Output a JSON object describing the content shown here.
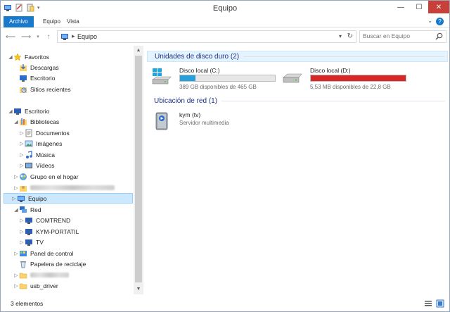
{
  "window": {
    "title": "Equipo"
  },
  "ribbon": {
    "tabs": [
      "Archivo",
      "Equipo",
      "Vista"
    ],
    "help": "?"
  },
  "address": {
    "path": "Equipo",
    "separator": "▸"
  },
  "search": {
    "placeholder": "Buscar en Equipo"
  },
  "nav": {
    "favorites": {
      "label": "Favoritos",
      "items": [
        "Descargas",
        "Escritorio",
        "Sitios recientes"
      ]
    },
    "desktop": {
      "label": "Escritorio"
    },
    "libraries": {
      "label": "Bibliotecas",
      "items": [
        "Documentos",
        "Imágenes",
        "Música",
        "Vídeos"
      ]
    },
    "homegroup": "Grupo en el hogar",
    "computer": "Equipo",
    "network": {
      "label": "Red",
      "items": [
        "COMTREND",
        "KYM-PORTATIL",
        "TV"
      ]
    },
    "control_panel": "Panel de control",
    "recycle_bin": "Papelera de reciclaje",
    "usb_driver": "usb_driver"
  },
  "content": {
    "drives_header": "Unidades de disco duro (2)",
    "drives": [
      {
        "name": "Disco local (C:)",
        "free": "389 GB disponibles de 465 GB",
        "used_fraction": 0.16,
        "bar_color": "#26a0da"
      },
      {
        "name": "Disco local (D:)",
        "free": "5,53 MB disponibles de 22,8 GB",
        "used_fraction": 1.0,
        "bar_color": "#da2626"
      }
    ],
    "network_header": "Ubicación de red (1)",
    "network_locations": [
      {
        "name": "kym (tv)",
        "type": "Servidor multimedia"
      }
    ]
  },
  "status": {
    "text": "3 elementos"
  },
  "colors": {
    "accent": "#1979ca",
    "selected": "#cce8ff",
    "header_text": "#1e3287"
  }
}
